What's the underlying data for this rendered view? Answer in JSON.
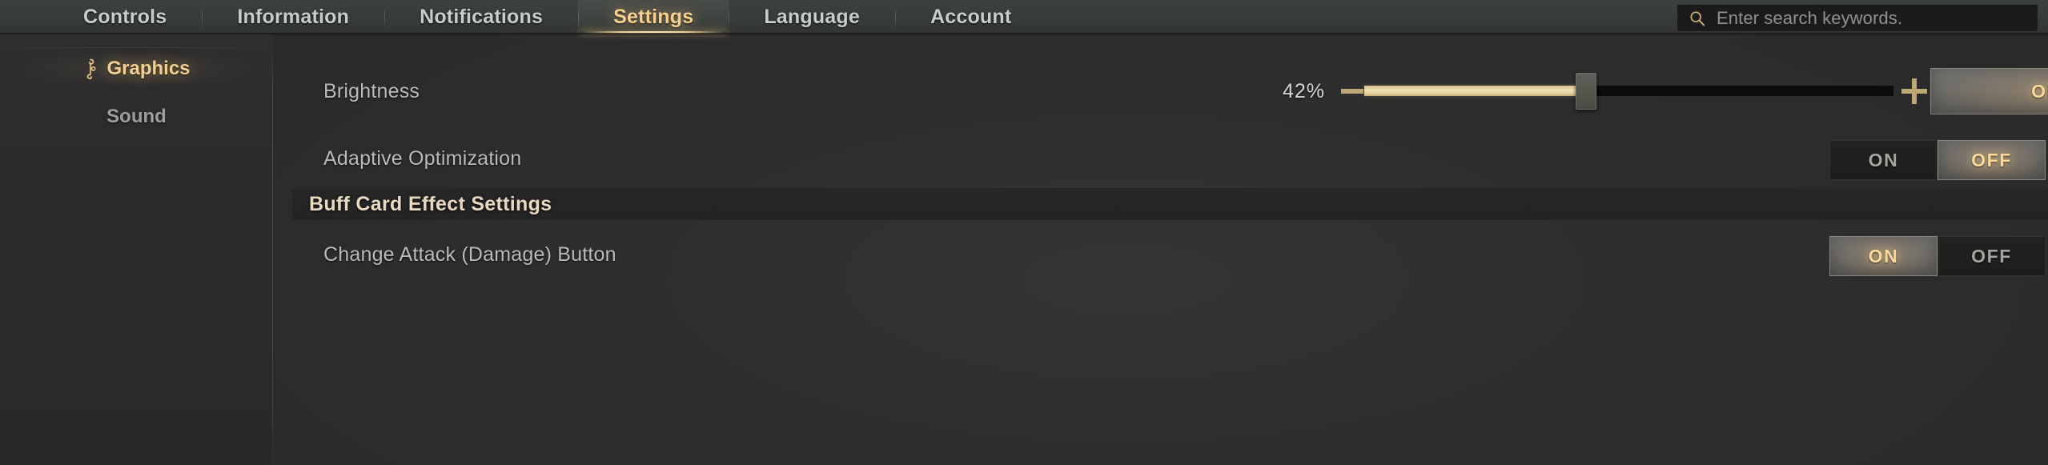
{
  "topbar": {
    "tabs": [
      {
        "label": "Controls",
        "active": false
      },
      {
        "label": "Information",
        "active": false
      },
      {
        "label": "Notifications",
        "active": false
      },
      {
        "label": "Settings",
        "active": true
      },
      {
        "label": "Language",
        "active": false
      },
      {
        "label": "Account",
        "active": false
      }
    ],
    "search": {
      "placeholder": "Enter search keywords.",
      "value": "",
      "icon": "search-icon"
    }
  },
  "sidebar": {
    "items": [
      {
        "label": "Graphics",
        "active": true,
        "icon": "ornament-icon"
      },
      {
        "label": "Sound",
        "active": false
      }
    ]
  },
  "main": {
    "rows": [
      {
        "label": "Brightness",
        "control": "slider",
        "slider": {
          "value_text": "42%",
          "percent": 42,
          "decrease_label": "−",
          "increase_label": "+"
        },
        "button": {
          "label": "ON",
          "state": "on"
        }
      },
      {
        "label": "Adaptive Optimization",
        "control": "toggle",
        "toggle": {
          "on_label": "ON",
          "off_label": "OFF",
          "selected": "OFF"
        }
      }
    ],
    "section": {
      "title": "Buff Card Effect Settings",
      "rows": [
        {
          "label": "Change Attack (Damage) Button",
          "control": "toggle",
          "toggle": {
            "on_label": "ON",
            "off_label": "OFF",
            "selected": "ON"
          }
        }
      ]
    }
  },
  "colors": {
    "gold": "#f4d193",
    "gold_bright": "#fad89a",
    "cream": "#e8d9c0",
    "text_grey": "#b9bcb8",
    "bg": "#2c2c2c",
    "band": "#262626",
    "slider_fill": "#e6d4a5",
    "slider_empty": "#0b0b0b"
  }
}
